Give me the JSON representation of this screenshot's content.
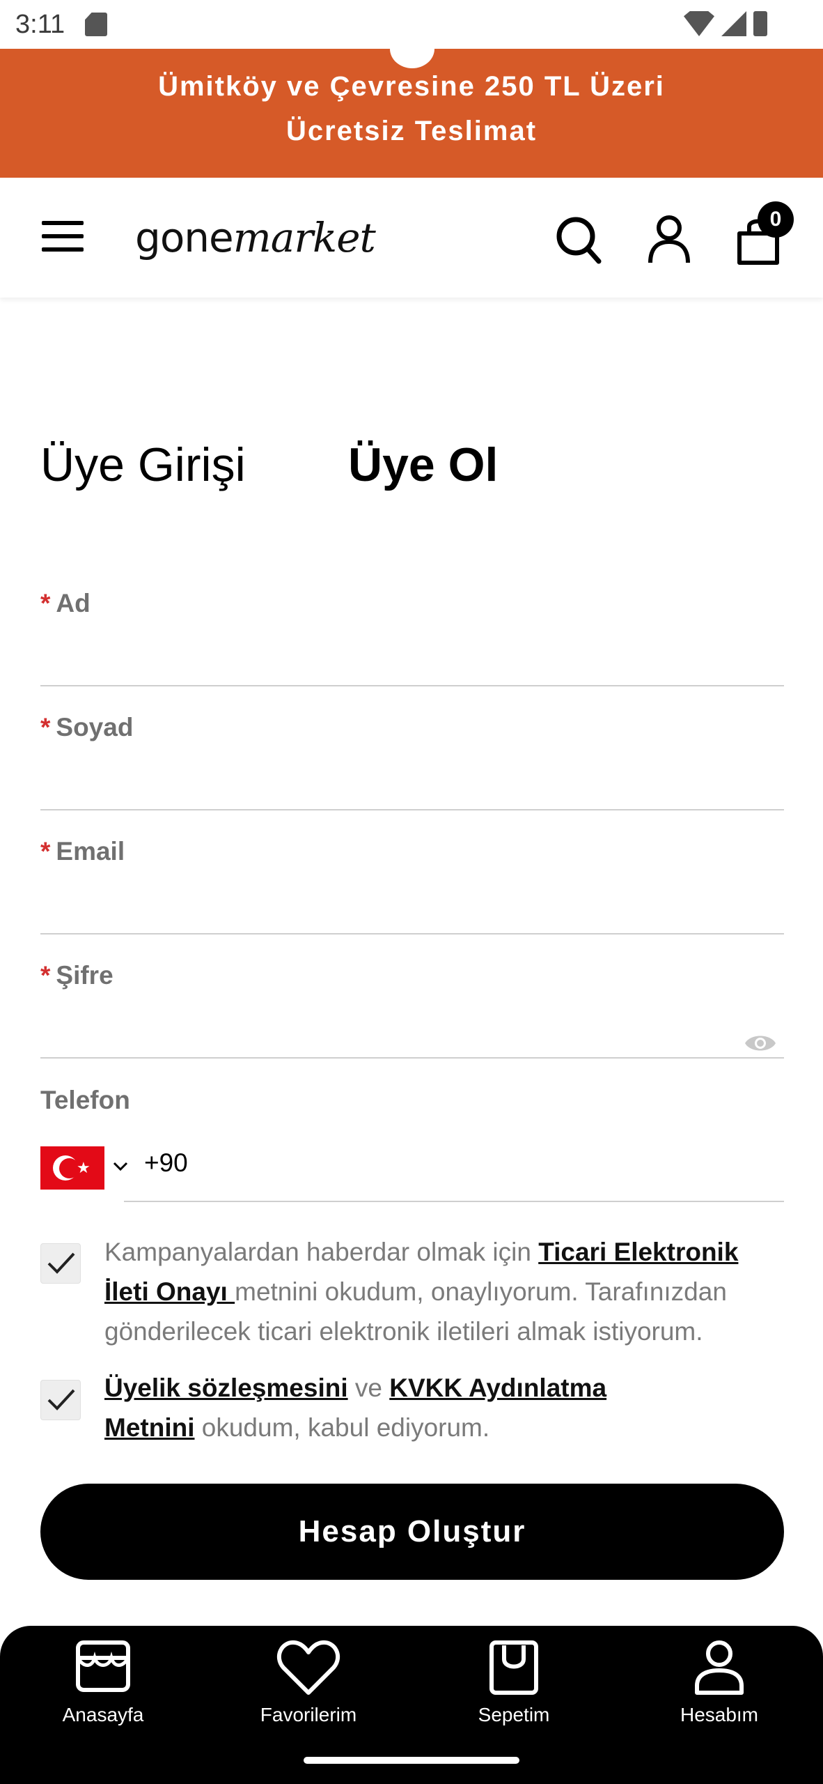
{
  "status_bar": {
    "time": "3:11"
  },
  "promo": {
    "line1": "Ümitköy ve Çevresine 250 TL Üzeri",
    "line2": "Ücretsiz Teslimat"
  },
  "header": {
    "logo_part1": "gone",
    "logo_part2": "market",
    "cart_count": "0"
  },
  "tabs": {
    "login": "Üye Girişi",
    "register": "Üye Ol"
  },
  "form": {
    "required_mark": "*",
    "fields": [
      {
        "label": "Ad",
        "value": ""
      },
      {
        "label": "Soyad",
        "value": ""
      },
      {
        "label": "Email",
        "value": ""
      },
      {
        "label": "Şifre",
        "value": ""
      }
    ],
    "phone": {
      "label": "Telefon",
      "prefix": "+90",
      "country": "Turkey"
    },
    "consent1": {
      "text_before": "Kampanyalardan haberdar olmak için ",
      "link": "Ticari Elektronik İleti Onayı ",
      "text_after": "metnini okudum, onaylıyorum. Tarafınızdan gönderilecek ticari elektronik iletileri almak istiyorum.",
      "checked": true
    },
    "consent2": {
      "link1": "Üyelik sözleşmesini",
      "middle": " ve ",
      "link2": "KVKK Aydınlatma Metnini",
      "text_after": " okudum, kabul ediyorum.",
      "checked": true
    },
    "submit_label": "Hesap Oluştur"
  },
  "bottom_nav": {
    "items": [
      {
        "label": "Anasayfa",
        "icon": "store-icon"
      },
      {
        "label": "Favorilerim",
        "icon": "heart-icon"
      },
      {
        "label": "Sepetim",
        "icon": "shopping-bag-icon"
      },
      {
        "label": "Hesabım",
        "icon": "user-icon"
      }
    ]
  },
  "colors": {
    "brand_orange": "#d65a28",
    "required_red": "#d32f2f",
    "primary_black": "#000000"
  }
}
